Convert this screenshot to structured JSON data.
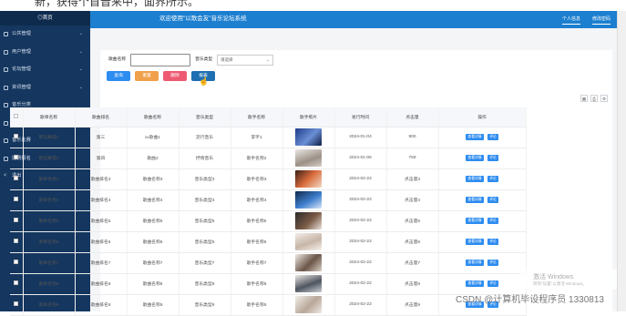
{
  "caption": "新，获得个首音来中，面界所示。",
  "sidebar": {
    "home": "◎首页",
    "items": [
      {
        "label": "公共管理",
        "has_chevron": true
      },
      {
        "label": "用户管理",
        "has_chevron": true
      },
      {
        "label": "论坛管理",
        "has_chevron": true
      },
      {
        "label": "资讯管理",
        "has_chevron": true
      },
      {
        "label": "音乐分类",
        "has_chevron": false
      },
      {
        "label": "轮播管理",
        "has_chevron": false
      },
      {
        "label": "音乐比赛",
        "has_chevron": false
      },
      {
        "label": "比赛报名",
        "has_chevron": false
      },
      {
        "label": "退出",
        "has_chevron": false,
        "icon": "share-icon"
      }
    ]
  },
  "topbar": {
    "title": "欢迎使用\"以歌会友\"音乐论坛系统",
    "personal": "个人信息",
    "change_password": "修改密码"
  },
  "search": {
    "name_label": "歌曲名称",
    "name_value": "",
    "type_label": "音乐类型",
    "type_value": "请选择"
  },
  "buttons": {
    "query": "查询",
    "reset": "重置",
    "delete": "删除",
    "report": "报表"
  },
  "colors": {
    "sidebar": "#14365f",
    "topbar": "#1c7fd0",
    "query": "#2d8cf0",
    "reset": "#f0a04a",
    "delete": "#ed5a72",
    "report": "#1f6fb2"
  },
  "table": {
    "headers": [
      "歌单名称",
      "歌曲排名",
      "歌曲名称",
      "音乐类型",
      "歌手名称",
      "歌手照片",
      "发行时间",
      "点击量",
      "操作"
    ],
    "rows": [
      {
        "name": "那些撒得1",
        "rank": "第三",
        "song": "xx歌曲1",
        "type": "流行音乐",
        "singer": "李宇1",
        "date": "2024-01-04",
        "clicks": "900"
      },
      {
        "name": "那些撒得2",
        "rank": "第四",
        "song": "歌曲2",
        "type": "抒情音乐",
        "singer": "歌手名称2",
        "date": "2024-01-06",
        "clicks": "759"
      },
      {
        "name": "歌单名称3",
        "rank": "歌曲排名3",
        "song": "歌曲名称3",
        "type": "音乐类型3",
        "singer": "歌手名称3",
        "date": "2024-02-22",
        "clicks": "点击量3"
      },
      {
        "name": "歌单名称4",
        "rank": "歌曲排名4",
        "song": "歌曲名称4",
        "type": "音乐类型4",
        "singer": "歌手名称4",
        "date": "2024-02-22",
        "clicks": "点击量4"
      },
      {
        "name": "歌单名称5",
        "rank": "歌曲排名5",
        "song": "歌曲名称5",
        "type": "音乐类型5",
        "singer": "歌手名称5",
        "date": "2024-02-22",
        "clicks": "点击量5"
      },
      {
        "name": "歌单名称6",
        "rank": "歌曲排名6",
        "song": "歌曲名称6",
        "type": "音乐类型6",
        "singer": "歌手名称6",
        "date": "2024-02-22",
        "clicks": "点击量6"
      },
      {
        "name": "歌单名称7",
        "rank": "歌曲排名7",
        "song": "歌曲名称7",
        "type": "音乐类型7",
        "singer": "歌手名称7",
        "date": "2024-02-22",
        "clicks": "点击量7"
      },
      {
        "name": "歌单名称8",
        "rank": "歌曲排名8",
        "song": "歌曲名称8",
        "type": "音乐类型8",
        "singer": "歌手名称8",
        "date": "2024-02-22",
        "clicks": "点击量8"
      },
      {
        "name": "歌单名称9",
        "rank": "歌曲排名9",
        "song": "歌曲名称9",
        "type": "音乐类型9",
        "singer": "歌手名称9",
        "date": "2024-02-22",
        "clicks": "点击量9"
      }
    ],
    "row_actions": {
      "detail": "查看详情",
      "edit": "评论"
    }
  },
  "windows_watermark": {
    "line1": "激活 Windows",
    "line2": "转到\"设置\"以激活 Windows。"
  },
  "csdn_watermark": "CSDN @计算机毕设程序员 1330813"
}
